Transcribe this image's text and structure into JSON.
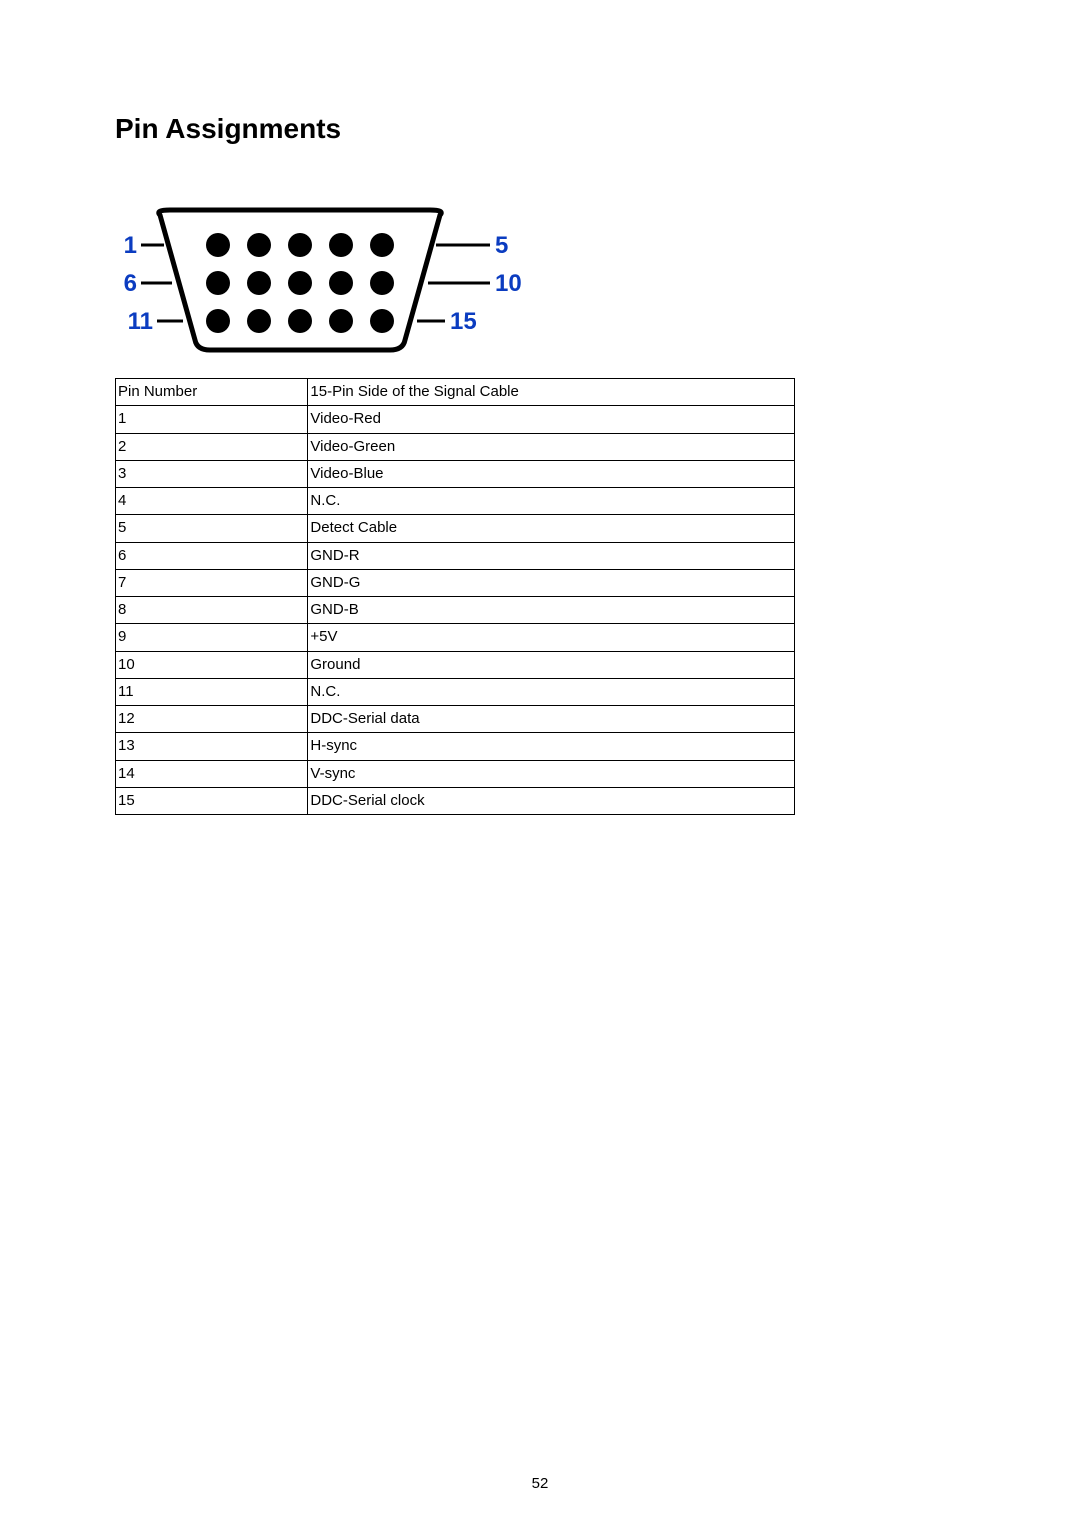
{
  "title": "Pin Assignments",
  "diagram": {
    "labels": {
      "left1": "1",
      "right1": "5",
      "left2": "6",
      "right2": "10",
      "left3": "11",
      "right3": "15"
    }
  },
  "table": {
    "headers": {
      "pin": "Pin Number",
      "desc": "15-Pin Side of the Signal Cable"
    },
    "rows": [
      {
        "pin": "1",
        "desc": "Video-Red"
      },
      {
        "pin": "2",
        "desc": "Video-Green"
      },
      {
        "pin": "3",
        "desc": "Video-Blue"
      },
      {
        "pin": "4",
        "desc": "N.C."
      },
      {
        "pin": "5",
        "desc": "Detect Cable"
      },
      {
        "pin": "6",
        "desc": "GND-R"
      },
      {
        "pin": "7",
        "desc": "GND-G"
      },
      {
        "pin": "8",
        "desc": "GND-B"
      },
      {
        "pin": "9",
        "desc": "+5V"
      },
      {
        "pin": "10",
        "desc": "Ground"
      },
      {
        "pin": "11",
        "desc": "N.C."
      },
      {
        "pin": "12",
        "desc": "DDC-Serial data"
      },
      {
        "pin": "13",
        "desc": "H-sync"
      },
      {
        "pin": "14",
        "desc": "V-sync"
      },
      {
        "pin": "15",
        "desc": "DDC-Serial clock"
      }
    ]
  },
  "page_number": "52"
}
